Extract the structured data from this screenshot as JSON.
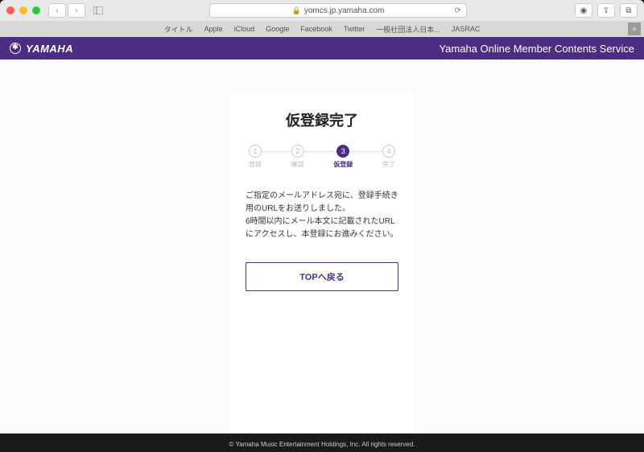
{
  "browser": {
    "url": "yomcs.jp.yamaha.com",
    "bookmarks": [
      "タイトル",
      "Apple",
      "iCloud",
      "Google",
      "Facebook",
      "Twitter",
      "一般社団法人日本...",
      "JASRAC"
    ]
  },
  "header": {
    "brand": "YAMAHA",
    "service": "Yamaha Online Member Contents Service"
  },
  "page": {
    "title": "仮登録完了",
    "steps": [
      {
        "num": "1",
        "label": "登録",
        "active": false
      },
      {
        "num": "2",
        "label": "確認",
        "active": false
      },
      {
        "num": "3",
        "label": "仮登録",
        "active": true
      },
      {
        "num": "4",
        "label": "完了",
        "active": false
      }
    ],
    "message_line1": "ご指定のメールアドレス宛に、登録手続き用のURLをお送りしました。",
    "message_line2": "6時間以内にメール本文に記載されたURLにアクセスし、本登録にお進みください。",
    "button": "TOPへ戻る"
  },
  "footer": {
    "copyright": "© Yamaha Music Entertainment Holdings, Inc. All rights reserved."
  }
}
